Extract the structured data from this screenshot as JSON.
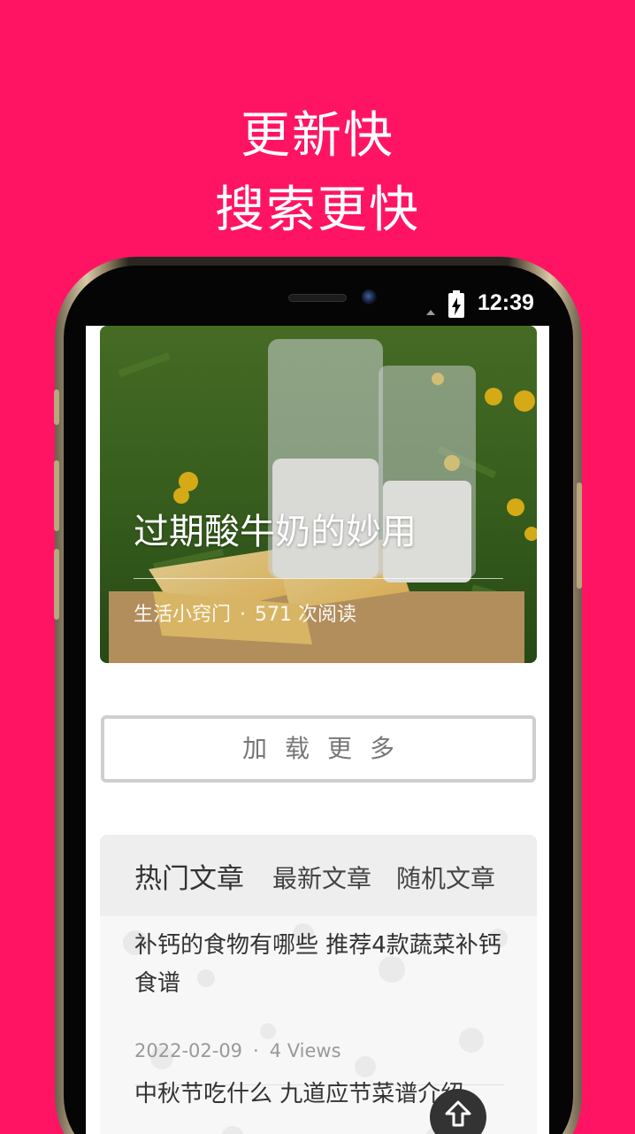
{
  "promo": {
    "line1": "更新快",
    "line2": "搜索更快"
  },
  "status_bar": {
    "time": "12:39",
    "icons": [
      "signal-icon",
      "battery-charging-icon"
    ]
  },
  "hero": {
    "title": "过期酸牛奶的妙用",
    "category": "生活小窍门",
    "separator": "·",
    "reads": "571 次阅读"
  },
  "load_more": {
    "label": "加载更多"
  },
  "article_tabs": [
    {
      "label": "热门文章",
      "active": true
    },
    {
      "label": "最新文章",
      "active": false
    },
    {
      "label": "随机文章",
      "active": false
    }
  ],
  "articles": [
    {
      "title": "补钙的食物有哪些 推荐4款蔬菜补钙食谱",
      "date": "2022-02-09",
      "separator": "·",
      "views": "4 Views"
    },
    {
      "title": "中秋节吃什么 九道应节菜谱介绍"
    }
  ],
  "colors": {
    "background": "#ff1463",
    "text_primary": "#333333",
    "text_muted": "#999999"
  }
}
